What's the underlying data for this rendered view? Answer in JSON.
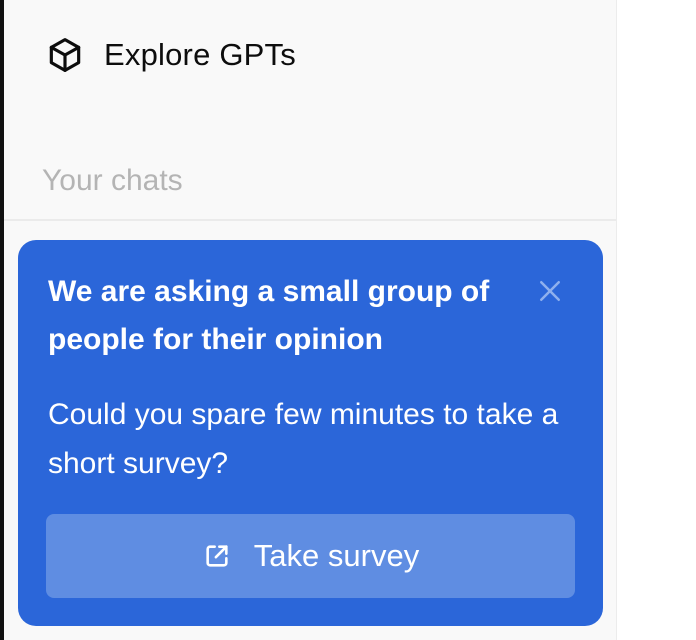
{
  "sidebar": {
    "nav_item": {
      "label": "Explore GPTs",
      "icon": "cube-icon"
    },
    "section_label": "Your chats"
  },
  "survey": {
    "title": "We are asking a small group of people for their opinion",
    "body": "Could you spare few minutes to take a short survey?",
    "button_label": "Take survey",
    "button_icon": "external-link-icon",
    "close_icon": "close-icon"
  },
  "colors": {
    "card_background": "#2b66d9",
    "button_background": "#5f8de2",
    "sidebar_background": "#f9f9f9",
    "muted_text": "#b4b4b4"
  }
}
